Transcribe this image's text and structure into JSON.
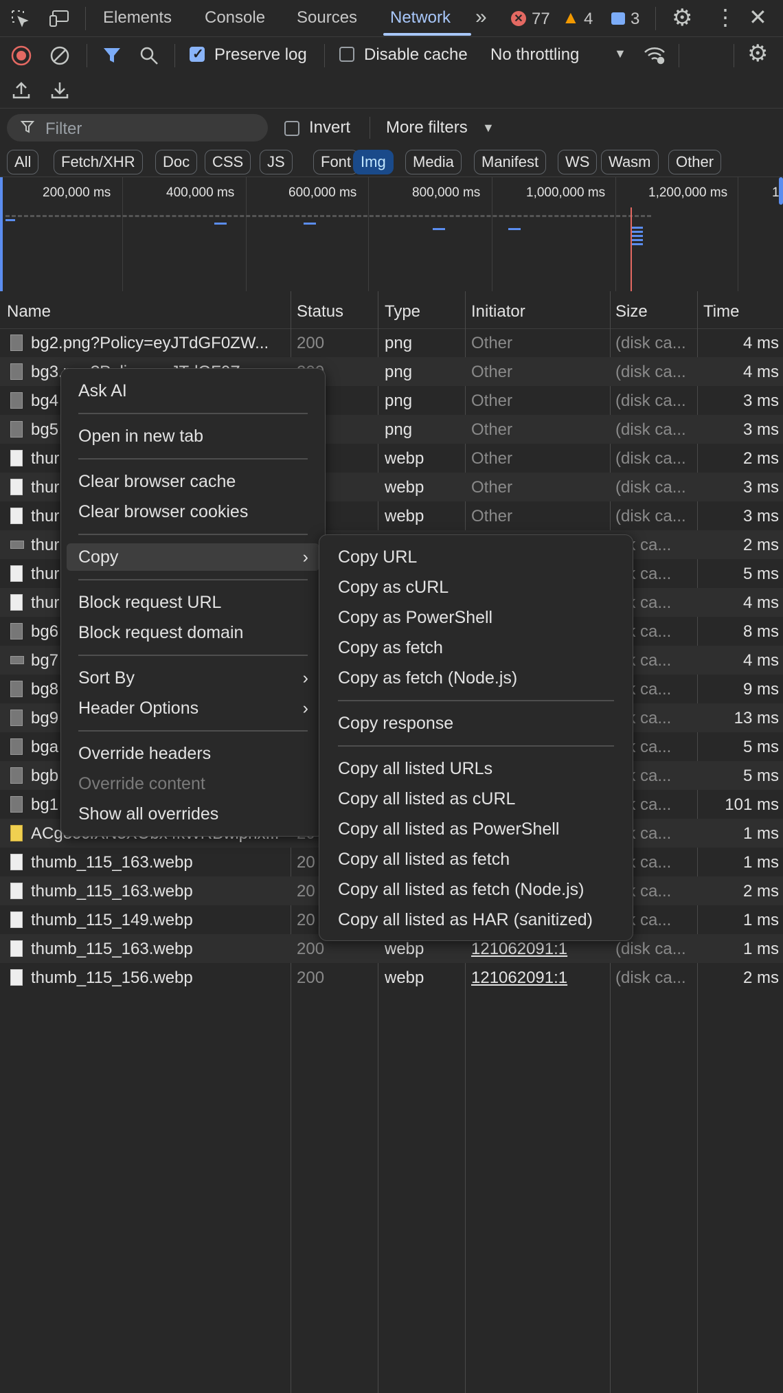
{
  "tabs": {
    "elements": "Elements",
    "console": "Console",
    "sources": "Sources",
    "network": "Network"
  },
  "status": {
    "errors": "77",
    "warnings": "4",
    "messages": "3"
  },
  "toolbar": {
    "preserve_log": "Preserve log",
    "disable_cache": "Disable cache",
    "throttling": "No throttling"
  },
  "filter": {
    "placeholder": "Filter",
    "invert": "Invert",
    "more_filters": "More filters"
  },
  "type_filters": [
    "All",
    "Fetch/XHR",
    "Doc",
    "CSS",
    "JS",
    "Font",
    "Img",
    "Media",
    "Manifest",
    "WS",
    "Wasm",
    "Other"
  ],
  "active_type_filter": "Img",
  "overview": {
    "labels": [
      "200,000 ms",
      "400,000 ms",
      "600,000 ms",
      "800,000 ms",
      "1,000,000 ms",
      "1,200,000 ms",
      "1"
    ]
  },
  "columns": {
    "name": "Name",
    "status": "Status",
    "type": "Type",
    "initiator": "Initiator",
    "size": "Size",
    "time": "Time"
  },
  "rows": [
    {
      "name": "bg2.png?Policy=eyJTdGF0ZW...",
      "status": "200",
      "type": "png",
      "initiator": "Other",
      "size": "(disk ca...",
      "time": "4 ms"
    },
    {
      "name": "bg3.png?Policy=eyJTdGF0Z...",
      "status": "200",
      "type": "png",
      "initiator": "Other",
      "size": "(disk ca...",
      "time": "4 ms"
    },
    {
      "name": "bg4",
      "status": "",
      "type": "png",
      "initiator": "Other",
      "size": "(disk ca...",
      "time": "3 ms"
    },
    {
      "name": "bg5",
      "status": "",
      "type": "png",
      "initiator": "Other",
      "size": "(disk ca...",
      "time": "3 ms"
    },
    {
      "name": "thur",
      "status": "",
      "type": "webp",
      "initiator": "Other",
      "size": "(disk ca...",
      "time": "2 ms"
    },
    {
      "name": "thur",
      "status": "",
      "type": "webp",
      "initiator": "Other",
      "size": "(disk ca...",
      "time": "3 ms"
    },
    {
      "name": "thur",
      "status": "",
      "type": "webp",
      "initiator": "Other",
      "size": "(disk ca...",
      "time": "3 ms"
    },
    {
      "name": "thur",
      "status": "",
      "type": "",
      "initiator": "",
      "size": "isk ca...",
      "time": "2 ms"
    },
    {
      "name": "thur",
      "status": "",
      "type": "",
      "initiator": "",
      "size": "isk ca...",
      "time": "5 ms"
    },
    {
      "name": "thur",
      "status": "",
      "type": "",
      "initiator": "",
      "size": "isk ca...",
      "time": "4 ms"
    },
    {
      "name": "bg6",
      "status": "",
      "type": "",
      "initiator": "",
      "size": "isk ca...",
      "time": "8 ms"
    },
    {
      "name": "bg7",
      "status": "",
      "type": "",
      "initiator": "",
      "size": "isk ca...",
      "time": "4 ms"
    },
    {
      "name": "bg8",
      "status": "",
      "type": "",
      "initiator": "",
      "size": "isk ca...",
      "time": "9 ms"
    },
    {
      "name": "bg9",
      "status": "",
      "type": "",
      "initiator": "",
      "size": "isk ca...",
      "time": "13 ms"
    },
    {
      "name": "bga",
      "status": "",
      "type": "",
      "initiator": "",
      "size": "isk ca...",
      "time": "5 ms"
    },
    {
      "name": "bgb",
      "status": "",
      "type": "",
      "initiator": "",
      "size": "isk ca...",
      "time": "5 ms"
    },
    {
      "name": "bg1",
      "status": "",
      "type": "",
      "initiator": "",
      "size": "isk ca...",
      "time": "101 ms"
    },
    {
      "name": "ACg8ocIXN3XObx4kWRBwiphx...",
      "status": "20",
      "type": "",
      "initiator": "",
      "size": "isk ca...",
      "time": "1 ms"
    },
    {
      "name": "thumb_115_163.webp",
      "status": "20",
      "type": "",
      "initiator": "",
      "size": "isk ca...",
      "time": "1 ms"
    },
    {
      "name": "thumb_115_163.webp",
      "status": "20",
      "type": "",
      "initiator": "",
      "size": "isk ca...",
      "time": "2 ms"
    },
    {
      "name": "thumb_115_149.webp",
      "status": "20",
      "type": "",
      "initiator": "",
      "size": "isk ca...",
      "time": "1 ms"
    },
    {
      "name": "thumb_115_163.webp",
      "status": "200",
      "type": "webp",
      "initiator": "121062091:1",
      "size": "(disk ca...",
      "time": "1 ms"
    },
    {
      "name": "thumb_115_156.webp",
      "status": "200",
      "type": "webp",
      "initiator": "121062091:1",
      "size": "(disk ca...",
      "time": "2 ms"
    }
  ],
  "context_menu": {
    "ask_ai": "Ask AI",
    "open_new_tab": "Open in new tab",
    "clear_cache": "Clear browser cache",
    "clear_cookies": "Clear browser cookies",
    "copy": "Copy",
    "block_url": "Block request URL",
    "block_domain": "Block request domain",
    "sort_by": "Sort By",
    "header_options": "Header Options",
    "override_headers": "Override headers",
    "override_content": "Override content",
    "show_overrides": "Show all overrides"
  },
  "copy_submenu": {
    "copy_url": "Copy URL",
    "copy_curl": "Copy as cURL",
    "copy_powershell": "Copy as PowerShell",
    "copy_fetch": "Copy as fetch",
    "copy_fetch_node": "Copy as fetch (Node.js)",
    "copy_response": "Copy response",
    "copy_all_urls": "Copy all listed URLs",
    "copy_all_curl": "Copy all listed as cURL",
    "copy_all_powershell": "Copy all listed as PowerShell",
    "copy_all_fetch": "Copy all listed as fetch",
    "copy_all_fetch_node": "Copy all listed as fetch (Node.js)",
    "copy_all_har": "Copy all listed as HAR (sanitized)"
  }
}
